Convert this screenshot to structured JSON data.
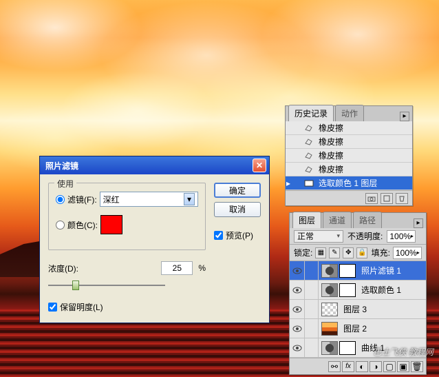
{
  "dialog": {
    "title": "照片滤镜",
    "group_label": "使用",
    "filter_radio": "滤镜(F):",
    "filter_value": "深红",
    "color_radio": "颜色(C):",
    "color_swatch": "#ff0000",
    "density_label": "浓度(D):",
    "density_value": "25",
    "density_unit": "%",
    "preserve_label": "保留明度(L)",
    "ok": "确定",
    "cancel": "取消",
    "preview": "预览(P)"
  },
  "history": {
    "tab_history": "历史记录",
    "tab_actions": "动作",
    "items": [
      {
        "label": "橡皮擦"
      },
      {
        "label": "橡皮擦"
      },
      {
        "label": "橡皮擦"
      },
      {
        "label": "橡皮擦"
      },
      {
        "label": "选取颜色 1 图层",
        "selected": true
      }
    ]
  },
  "layers": {
    "tab_layers": "图层",
    "tab_channels": "通道",
    "tab_paths": "路径",
    "blend_mode": "正常",
    "opacity_label": "不透明度:",
    "opacity_value": "100%",
    "lock_label": "锁定:",
    "fill_label": "填充:",
    "fill_value": "100%",
    "items": [
      {
        "name": "照片滤镜 1",
        "selected": true,
        "type": "adj"
      },
      {
        "name": "选取颜色 1",
        "type": "adj"
      },
      {
        "name": "图层 3",
        "type": "checker"
      },
      {
        "name": "图层 2",
        "type": "img"
      },
      {
        "name": "曲线 1",
        "type": "adj"
      }
    ]
  },
  "watermark": "巴士飞侠 教程网"
}
